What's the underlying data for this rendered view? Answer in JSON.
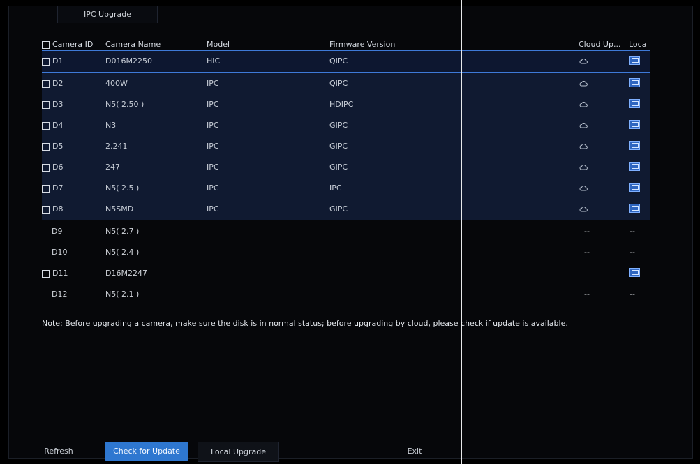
{
  "tab": {
    "title": "IPC Upgrade"
  },
  "table": {
    "headers": {
      "camera_id": "Camera ID",
      "camera_name": "Camera Name",
      "model": "Model",
      "firmware": "Firmware Version",
      "cloud": "Cloud Up...",
      "local": "Loca"
    },
    "rows": [
      {
        "id": "D1",
        "name": "D016M2250",
        "model": "HIC",
        "firmware": "QIPC",
        "cloud": "cloud-icon",
        "local": "upload-icon"
      },
      {
        "id": "D2",
        "name": "400W",
        "model": "IPC",
        "firmware": "QIPC",
        "cloud": "cloud-icon",
        "local": "upload-icon"
      },
      {
        "id": "D3",
        "name": "N5( 2.50 )",
        "model": "IPC",
        "firmware": "HDIPC",
        "cloud": "cloud-icon",
        "local": "upload-icon"
      },
      {
        "id": "D4",
        "name": "N3",
        "model": "IPC",
        "firmware": "GIPC",
        "cloud": "cloud-icon",
        "local": "upload-icon"
      },
      {
        "id": "D5",
        "name": "2.241",
        "model": "IPC",
        "firmware": "GIPC",
        "cloud": "cloud-icon",
        "local": "upload-icon"
      },
      {
        "id": "D6",
        "name": "247",
        "model": "IPC",
        "firmware": "GIPC",
        "cloud": "cloud-icon",
        "local": "upload-icon"
      },
      {
        "id": "D7",
        "name": "N5( 2.5 )",
        "model": "IPC",
        "firmware": "IPC",
        "cloud": "cloud-icon",
        "local": "upload-icon"
      },
      {
        "id": "D8",
        "name": "N5SMD",
        "model": "IPC",
        "firmware": "GIPC",
        "cloud": "cloud-icon",
        "local": "upload-icon"
      },
      {
        "id": "D9",
        "name": "N5( 2.7 )",
        "model": "",
        "firmware": "",
        "cloud": "--",
        "local": "--"
      },
      {
        "id": "D10",
        "name": "N5( 2.4 )",
        "model": "",
        "firmware": "",
        "cloud": "--",
        "local": "--"
      },
      {
        "id": "D11",
        "name": "D16M2247",
        "model": "",
        "firmware": "",
        "cloud": "",
        "local": "upload-icon"
      },
      {
        "id": "D12",
        "name": "N5( 2.1 )",
        "model": "",
        "firmware": "",
        "cloud": "--",
        "local": "--"
      }
    ]
  },
  "note": {
    "text": "Note: Before upgrading a camera, make sure the disk is in normal status; before upgrading by cloud, please check if update is available."
  },
  "buttons": {
    "refresh": "Refresh",
    "check": "Check for Update",
    "local": "Local Upgrade",
    "exit": "Exit"
  }
}
